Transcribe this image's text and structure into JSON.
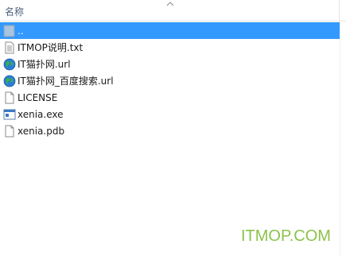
{
  "header": {
    "name_column": "名称"
  },
  "files": [
    {
      "name": "..",
      "icon": "folder-up-icon",
      "selected": true
    },
    {
      "name": "ITMOP说明.txt",
      "icon": "text-file-icon",
      "selected": false
    },
    {
      "name": "IT猫扑网.url",
      "icon": "internet-shortcut-icon",
      "selected": false
    },
    {
      "name": "IT猫扑网_百度搜索.url",
      "icon": "internet-shortcut-icon",
      "selected": false
    },
    {
      "name": "LICENSE",
      "icon": "blank-file-icon",
      "selected": false
    },
    {
      "name": "xenia.exe",
      "icon": "application-icon",
      "selected": false
    },
    {
      "name": "xenia.pdb",
      "icon": "blank-file-icon",
      "selected": false
    }
  ],
  "watermark": "ITMOP.COM",
  "colors": {
    "selection": "#3399ff",
    "header_text": "#4c607a",
    "watermark": "#8bc34a"
  }
}
